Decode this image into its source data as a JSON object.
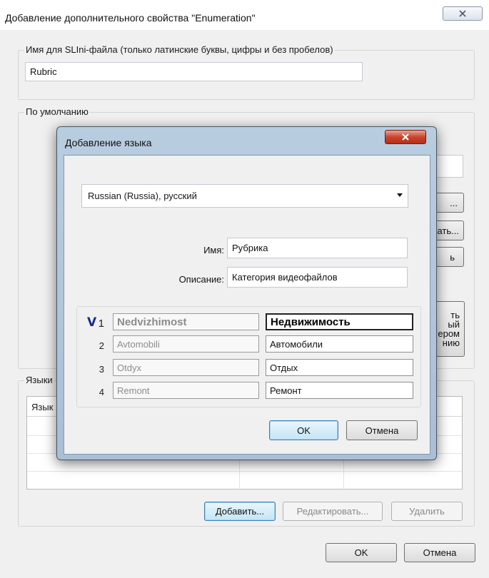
{
  "outer": {
    "title": "Добавление дополнительного свойства \"Enumeration\"",
    "sli_group": {
      "legend": "Имя для SLIni-файла (только латинские буквы, цифры и без пробелов)",
      "value": "Rubric"
    },
    "default_group": {
      "legend": "По умолчанию",
      "hidden_buttons": [
        "...",
        "ать...",
        "ь",
        "ть\nый\nером\nнию"
      ]
    },
    "languages_group": {
      "legend": "Языки",
      "column_header": "Язык",
      "add_label": "Добавить...",
      "edit_label": "Редактировать...",
      "delete_label": "Удалить"
    },
    "ok_label": "OK",
    "cancel_label": "Отмена"
  },
  "inner": {
    "title": "Добавление языка",
    "language": "Russian (Russia), русский",
    "name_label": "Имя:",
    "name_value": "Рубрика",
    "description_label": "Описание:",
    "description_value": "Категория видеофайлов",
    "check_mark": "V",
    "values": [
      {
        "num": "1",
        "source": "Nedvizhimost",
        "translation": "Недвижимость"
      },
      {
        "num": "2",
        "source": "Avtomobili",
        "translation": "Автомобили"
      },
      {
        "num": "3",
        "source": "Otdyx",
        "translation": "Отдых"
      },
      {
        "num": "4",
        "source": "Remont",
        "translation": "Ремонт"
      }
    ],
    "ok_label": "OK",
    "cancel_label": "Отмена"
  },
  "colors": {
    "inner_frame": "#b9cde0",
    "close_red": "#c9452d",
    "check_blue": "#1a2c8a"
  }
}
